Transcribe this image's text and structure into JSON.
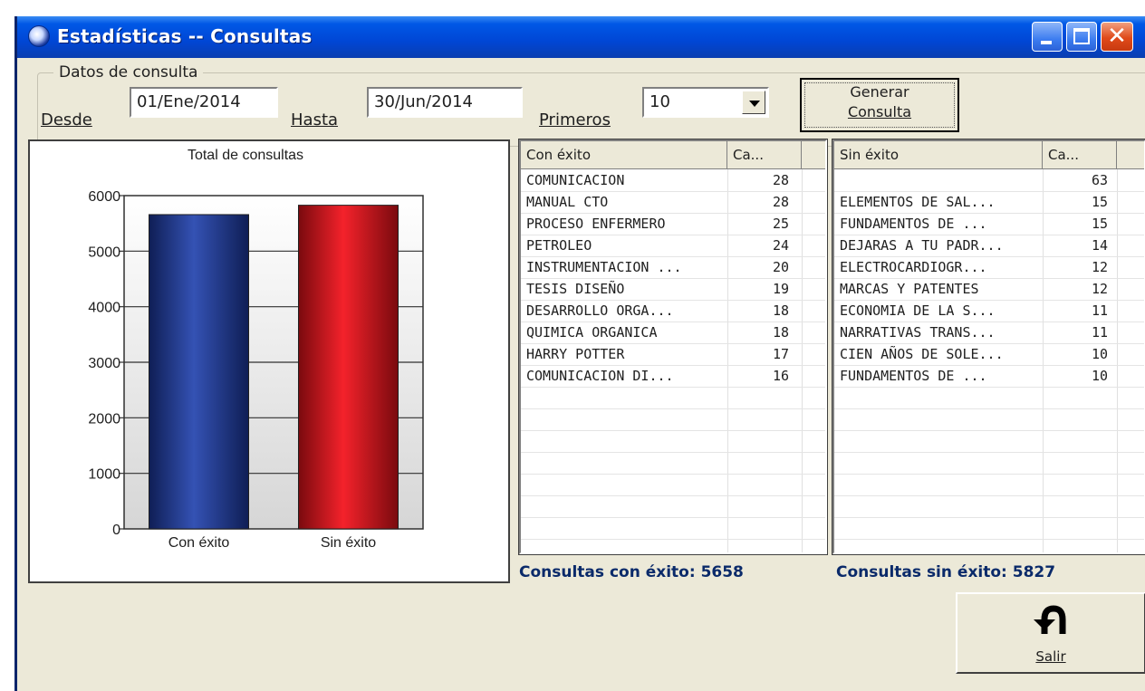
{
  "window": {
    "title": "Estadísticas -- Consultas"
  },
  "query": {
    "group_label": "Datos de consulta",
    "desde_label": "Desde",
    "desde_value": "01/Ene/2014",
    "hasta_label": "Hasta",
    "hasta_value": "30/Jun/2014",
    "primeros_label": "Primeros",
    "primeros_value": "10",
    "generate_line1": "Generar",
    "generate_line2": "Consulta"
  },
  "chart_data": {
    "type": "bar",
    "title": "Total de consultas",
    "categories": [
      "Con éxito",
      "Sin éxito"
    ],
    "values": [
      5658,
      5827
    ],
    "colors": [
      "#1F3A8F",
      "#E0161E"
    ],
    "ylim": [
      0,
      6000
    ],
    "yticks": [
      0,
      1000,
      2000,
      3000,
      4000,
      5000,
      6000
    ],
    "grid": true
  },
  "list_success": {
    "col1": "Con éxito",
    "col2": "Ca...",
    "rows": [
      {
        "name": "COMUNICACION",
        "count": "28"
      },
      {
        "name": "MANUAL CTO",
        "count": "28"
      },
      {
        "name": "PROCESO ENFERMERO",
        "count": "25"
      },
      {
        "name": "PETROLEO",
        "count": "24"
      },
      {
        "name": "INSTRUMENTACION ...",
        "count": "20"
      },
      {
        "name": "TESIS DISEÑO",
        "count": "19"
      },
      {
        "name": "DESARROLLO ORGA...",
        "count": "18"
      },
      {
        "name": "QUIMICA ORGANICA",
        "count": "18"
      },
      {
        "name": "HARRY POTTER",
        "count": "17"
      },
      {
        "name": "COMUNICACION DI...",
        "count": "16"
      }
    ]
  },
  "list_fail": {
    "col1": "Sin éxito",
    "col2": "Ca...",
    "rows": [
      {
        "name": "",
        "count": "63"
      },
      {
        "name": "ELEMENTOS DE SAL...",
        "count": "15"
      },
      {
        "name": "FUNDAMENTOS DE ...",
        "count": "15"
      },
      {
        "name": "DEJARAS A TU PADR...",
        "count": "14"
      },
      {
        "name": "ELECTROCARDIOGR...",
        "count": "12"
      },
      {
        "name": "MARCAS Y PATENTES",
        "count": "12"
      },
      {
        "name": "ECONOMIA DE LA S...",
        "count": "11"
      },
      {
        "name": "NARRATIVAS TRANS...",
        "count": "11"
      },
      {
        "name": "CIEN AÑOS DE SOLE...",
        "count": "10"
      },
      {
        "name": "FUNDAMENTOS DE ...",
        "count": "10"
      }
    ]
  },
  "summary": {
    "success": "Consultas con éxito: 5658",
    "fail": "Consultas sin éxito: 5827"
  },
  "exit_button": {
    "label": "Salir",
    "icon": "u-turn-arrow-icon"
  }
}
